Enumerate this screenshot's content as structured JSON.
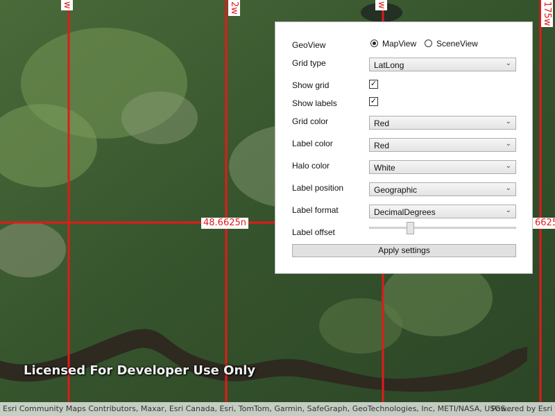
{
  "map": {
    "grid_line_color": "#e11a1a",
    "lon_labels": [
      "w",
      "2w",
      "w",
      "175w"
    ],
    "lat_labels": [
      "48.6625n",
      "6625"
    ],
    "watermark": "Licensed For Developer Use Only",
    "attribution": "Esri Community Maps Contributors, Maxar, Esri Canada, Esri, TomTom, Garmin, SafeGraph, GeoTechnologies, Inc, METI/NASA, USGS...",
    "powered_by": "Powered by Esri"
  },
  "panel": {
    "geoview_label": "GeoView",
    "mapview_label": "MapView",
    "sceneview_label": "SceneView",
    "geoview_selected": "MapView",
    "grid_type_label": "Grid type",
    "grid_type_value": "LatLong",
    "show_grid_label": "Show grid",
    "show_grid_checked": true,
    "show_labels_label": "Show labels",
    "show_labels_checked": true,
    "grid_color_label": "Grid color",
    "grid_color_value": "Red",
    "label_color_label": "Label color",
    "label_color_value": "Red",
    "halo_color_label": "Halo color",
    "halo_color_value": "White",
    "label_position_label": "Label position",
    "label_position_value": "Geographic",
    "label_format_label": "Label format",
    "label_format_value": "DecimalDegrees",
    "label_offset_label": "Label offset",
    "label_offset_fraction": 0.27,
    "apply_label": "Apply settings"
  }
}
